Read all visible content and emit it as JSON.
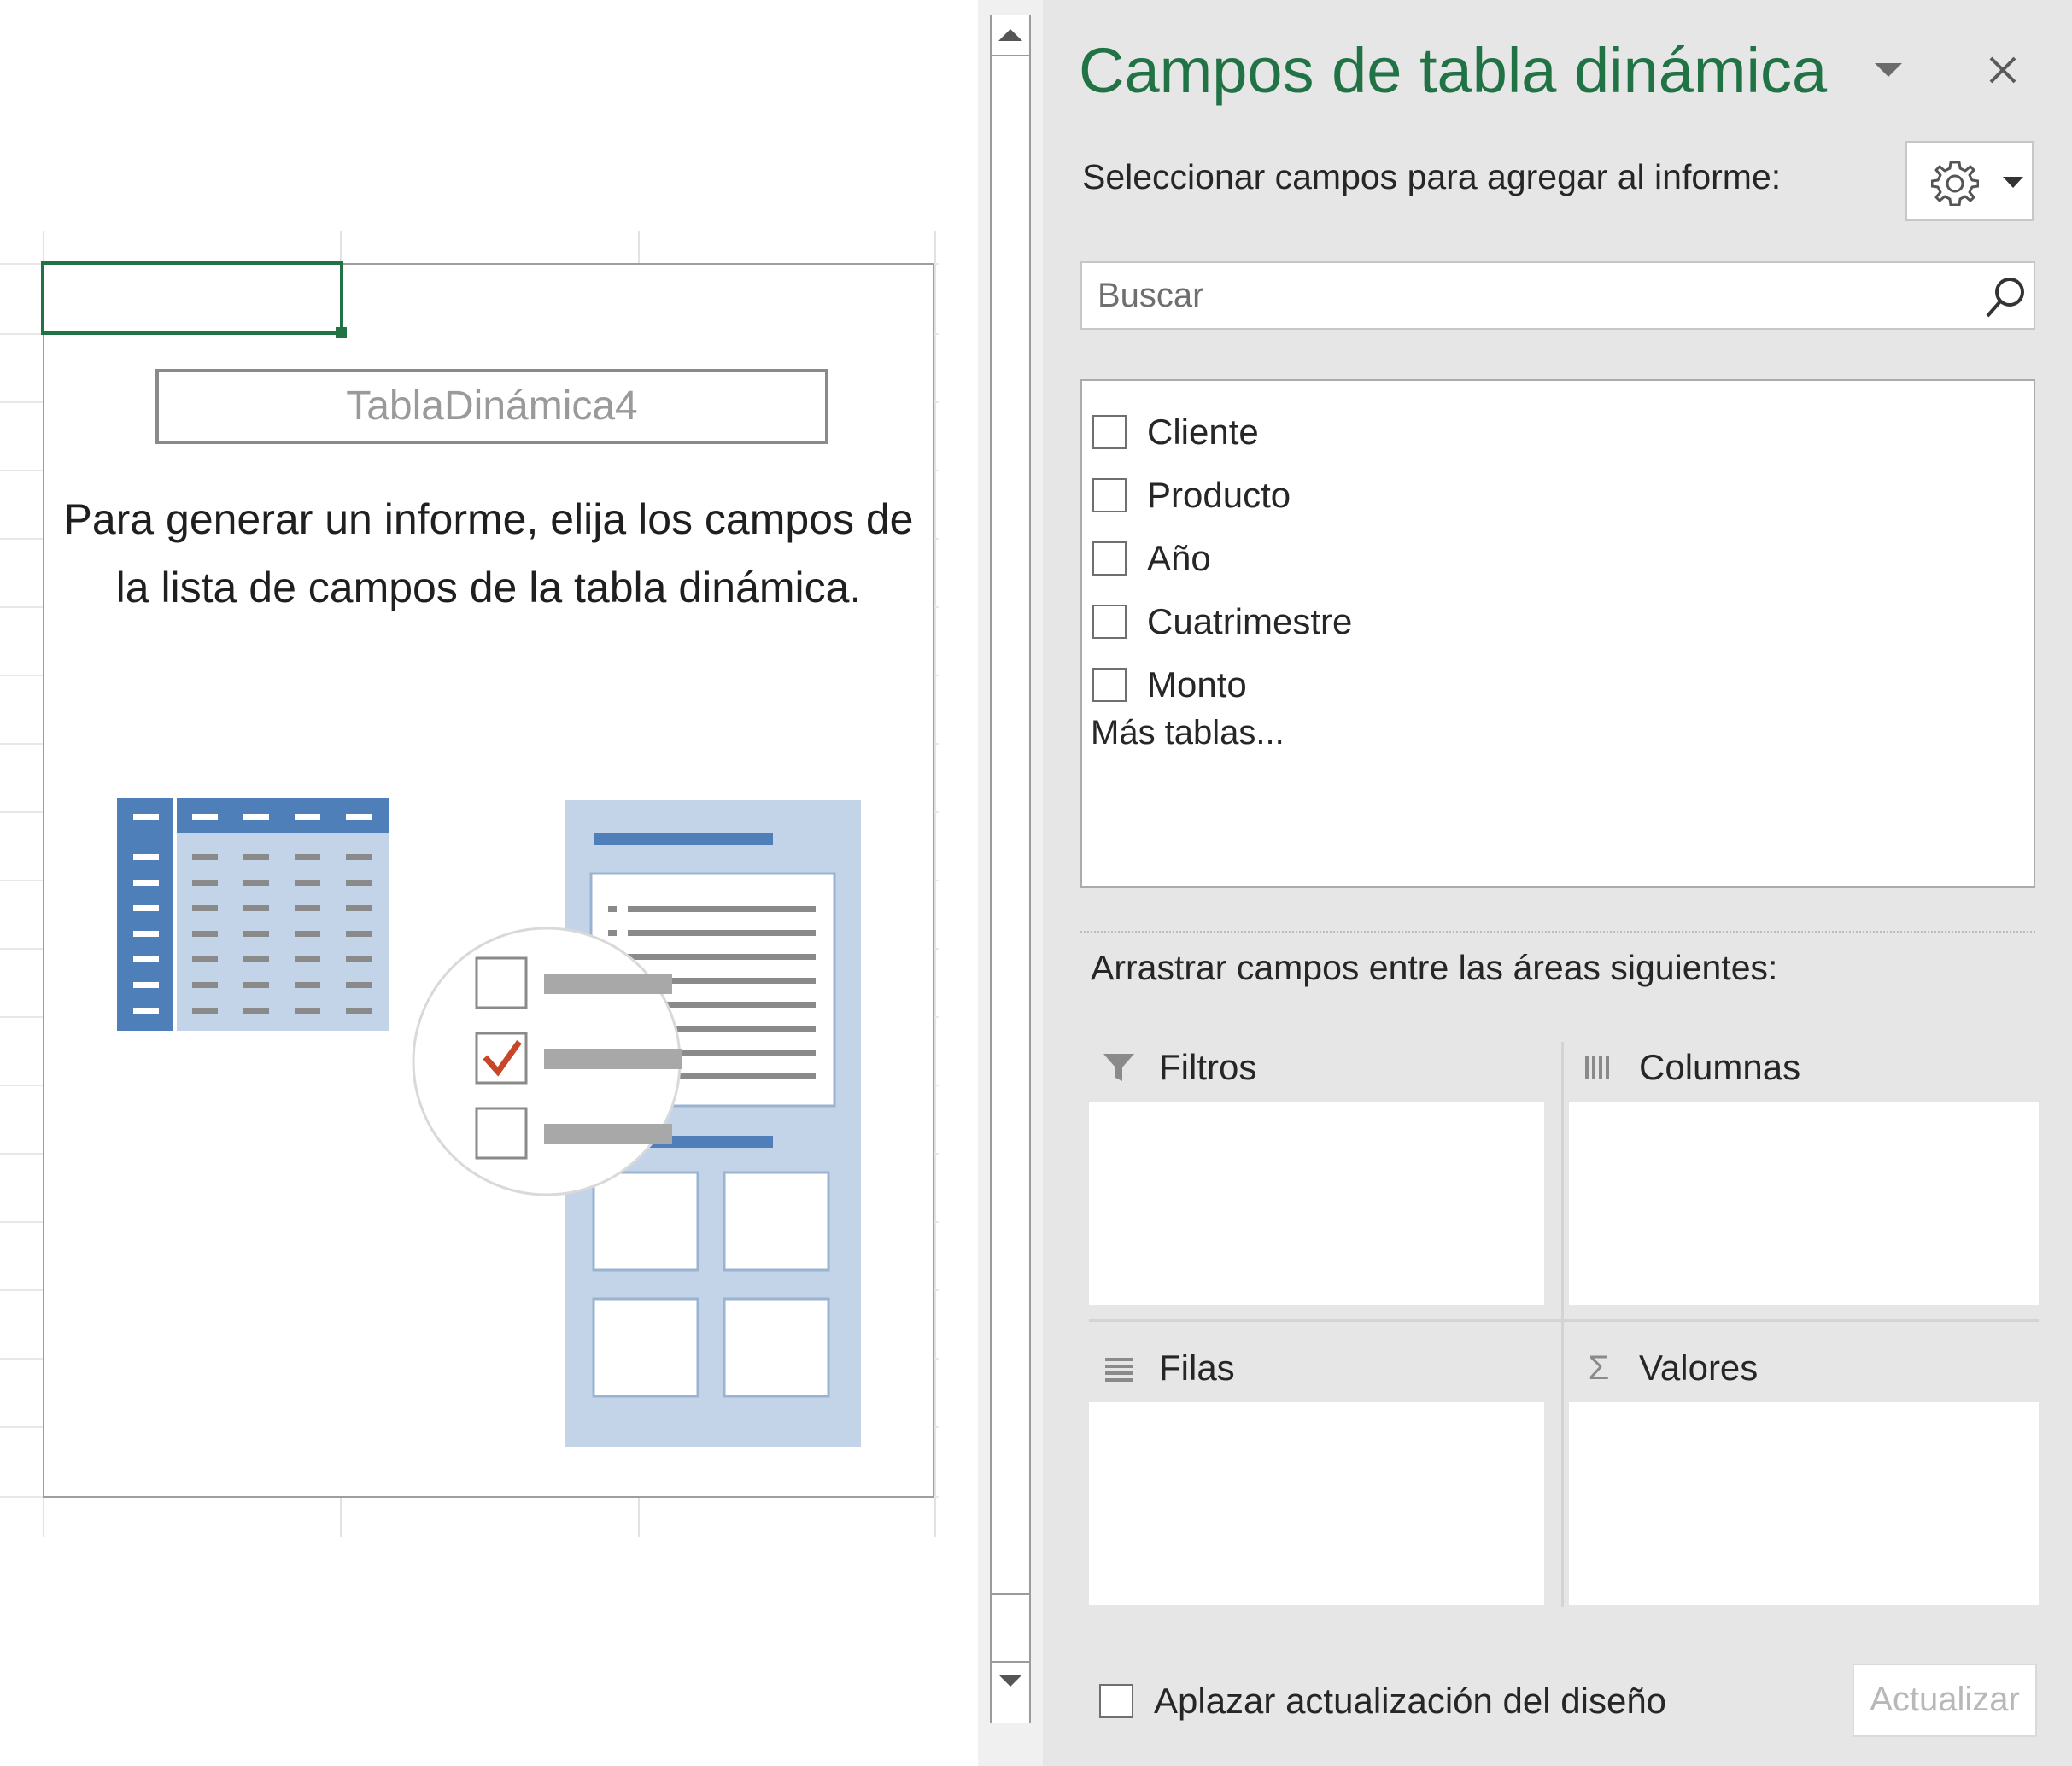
{
  "sheet": {
    "pivot_table_name": "TablaDinámica4",
    "instructions": "Para generar un informe, elija los campos de la lista de campos de la tabla dinámica."
  },
  "pane": {
    "title": "Campos de tabla dinámica",
    "select_label": "Seleccionar campos para agregar al informe:",
    "search": {
      "placeholder": "Buscar",
      "value": ""
    },
    "fields": [
      {
        "label": "Cliente",
        "checked": false
      },
      {
        "label": "Producto",
        "checked": false
      },
      {
        "label": "Año",
        "checked": false
      },
      {
        "label": "Cuatrimestre",
        "checked": false
      },
      {
        "label": "Monto",
        "checked": false
      }
    ],
    "more_tables": "Más tablas...",
    "drag_label": "Arrastrar campos entre las áreas siguientes:",
    "areas": {
      "filters": "Filtros",
      "columns": "Columnas",
      "rows": "Filas",
      "values": "Valores"
    },
    "defer_update": {
      "label": "Aplazar actualización del diseño",
      "checked": false
    },
    "update_button": "Actualizar"
  },
  "colors": {
    "accent": "#217346",
    "pane_background": "#e6e6e6",
    "illustration_dark_blue": "#4e7fb8",
    "illustration_light_blue": "#c3d4e8",
    "check_mark": "#c8472a"
  },
  "icons": [
    "gear-icon",
    "search-icon",
    "close-icon",
    "filter-icon",
    "columns-icon",
    "rows-icon",
    "sigma-icon"
  ]
}
